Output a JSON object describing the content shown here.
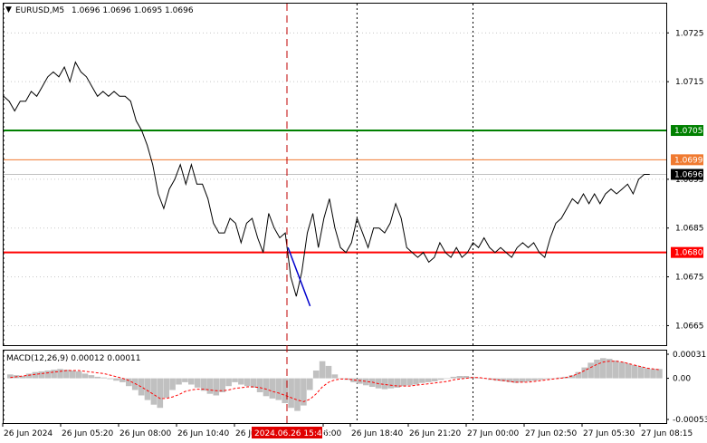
{
  "chart_header": {
    "symbol_label": "EURUSD,M5",
    "ohlc": "1.0696 1.0696 1.0695 1.0696"
  },
  "macd_header": {
    "label": "MACD(12,26,9) 0.00012 0.00011"
  },
  "price_axis_ticks": [
    "1.0725",
    "1.0715",
    "1.0695",
    "1.0685",
    "1.0675",
    "1.0665"
  ],
  "price_axis_tick_values": [
    1.0725,
    1.0715,
    1.0695,
    1.0685,
    1.0675,
    1.0665
  ],
  "macd_axis_ticks": [
    "0.00031",
    "0.00",
    "-0.00053"
  ],
  "macd_axis_tick_values": [
    0.00031,
    0.0,
    -0.00053
  ],
  "time_axis_labels": [
    "26 Jun 2024",
    "26 Jun 05:20",
    "26 Jun 08:00",
    "26 Jun 10:40",
    "26 Jun",
    "6:00",
    "26 Jun 18:40",
    "26 Jun 21:20",
    "27 Jun 00:00",
    "27 Jun 02:50",
    "27 Jun 05:30",
    "27 Jun 08:15"
  ],
  "crosshair_time": "2024.06.26 15:45",
  "levels": [
    {
      "name": "green-level",
      "price": 1.0705,
      "label": "1.0705",
      "color": "#008000"
    },
    {
      "name": "orange-level",
      "price": 1.0699,
      "label": "1.0699",
      "color": "#f07a30"
    },
    {
      "name": "red-level",
      "price": 1.068,
      "label": "1.0680",
      "color": "#ff0000"
    },
    {
      "name": "current-price",
      "price": 1.0696,
      "label": "1.0696",
      "color": "#000000"
    }
  ],
  "colors": {
    "price_line": "#000000",
    "macd_histogram": "#c0c0c0",
    "macd_signal": "#ff0000",
    "trend_line": "#0000cc",
    "crosshair": "#c00000",
    "grid": "#c8c8c8",
    "time_tag_bg": "#e00000"
  },
  "chart_data": [
    {
      "type": "line",
      "title": "EURUSD,M5",
      "ylim": [
        1.0661,
        1.0731
      ],
      "x_index_range": [
        0,
        120
      ],
      "x_major": [
        0,
        64,
        85
      ],
      "y": [
        1.0712,
        1.0711,
        1.0709,
        1.0711,
        1.0711,
        1.0713,
        1.0712,
        1.0714,
        1.0716,
        1.0717,
        1.0716,
        1.0718,
        1.0715,
        1.0719,
        1.0717,
        1.0716,
        1.0714,
        1.0712,
        1.0713,
        1.0712,
        1.0713,
        1.0712,
        1.0712,
        1.0711,
        1.0707,
        1.0705,
        1.0702,
        1.0698,
        1.0692,
        1.0689,
        1.0693,
        1.0695,
        1.0698,
        1.0694,
        1.0698,
        1.0694,
        1.0694,
        1.0691,
        1.0686,
        1.0684,
        1.0684,
        1.0687,
        1.0686,
        1.0682,
        1.0686,
        1.0687,
        1.0683,
        1.068,
        1.0688,
        1.0685,
        1.0683,
        1.0684,
        1.0675,
        1.0671,
        1.0676,
        1.0684,
        1.0688,
        1.0681,
        1.0687,
        1.0691,
        1.0685,
        1.0681,
        1.068,
        1.0682,
        1.0687,
        1.0684,
        1.0681,
        1.0685,
        1.0685,
        1.0684,
        1.0686,
        1.069,
        1.0687,
        1.0681,
        1.068,
        1.0679,
        1.068,
        1.0678,
        1.0679,
        1.0682,
        1.068,
        1.0679,
        1.0681,
        1.0679,
        1.068,
        1.0682,
        1.0681,
        1.0683,
        1.0681,
        1.068,
        1.0681,
        1.068,
        1.0679,
        1.0681,
        1.0682,
        1.0681,
        1.0682,
        1.068,
        1.0679,
        1.0683,
        1.0686,
        1.0687,
        1.0689,
        1.0691,
        1.069,
        1.0692,
        1.069,
        1.0692,
        1.069,
        1.0692,
        1.0693,
        1.0692,
        1.0693,
        1.0694,
        1.0692,
        1.0695,
        1.0696,
        1.0696
      ],
      "trend_line": {
        "start": [
          51.5,
          1.0681
        ],
        "end": [
          55.5,
          1.0669
        ]
      },
      "levels": [
        1.0705,
        1.0699,
        1.068
      ]
    },
    {
      "type": "bar",
      "title": "MACD(12,26,9)",
      "ylim": [
        -0.00053,
        0.00031
      ],
      "histogram": [
        5e-05,
        4e-05,
        3e-05,
        6e-05,
        8e-05,
        9e-05,
        0.0001,
        0.00011,
        0.00012,
        0.00011,
        0.0001,
        9e-05,
        6e-05,
        4e-05,
        2e-05,
        1e-05,
        -1e-05,
        -3e-05,
        -5e-05,
        -0.0001,
        -0.00015,
        -0.00022,
        -0.00028,
        -0.00034,
        -0.00038,
        -0.00025,
        -0.00015,
        -8e-05,
        -5e-05,
        -8e-05,
        -0.00012,
        -0.00016,
        -0.0002,
        -0.00022,
        -0.00018,
        -0.0001,
        -5e-05,
        -8e-05,
        -0.0001,
        -0.00012,
        -0.00018,
        -0.00023,
        -0.00026,
        -0.00028,
        -0.00032,
        -0.00038,
        -0.00042,
        -0.00035,
        -0.00015,
        0.0001,
        0.00022,
        0.00016,
        5e-05,
        0.0,
        -2e-05,
        -5e-05,
        -7e-05,
        -9e-05,
        -0.00011,
        -0.00013,
        -0.00014,
        -0.00013,
        -0.00012,
        -0.0001,
        -9e-05,
        -8e-05,
        -6e-05,
        -5e-05,
        -4e-05,
        -2e-05,
        0.0,
        2e-05,
        3e-05,
        3e-05,
        2e-05,
        1e-05,
        0.0,
        -2e-05,
        -3e-05,
        -4e-05,
        -5e-05,
        -6e-05,
        -5e-05,
        -4e-05,
        -3e-05,
        -2e-05,
        -1e-05,
        0.0,
        1e-05,
        2e-05,
        4e-05,
        8e-05,
        0.00014,
        0.0002,
        0.00024,
        0.00026,
        0.00025,
        0.00023,
        0.00021,
        0.00019,
        0.00017,
        0.00015,
        0.00013,
        0.00012,
        0.00012
      ],
      "signal": [
        1e-05,
        2e-05,
        3e-05,
        4e-05,
        5e-05,
        6e-05,
        7e-05,
        8e-05,
        9e-05,
        0.0001,
        0.0001,
        0.0001,
        9e-05,
        8e-05,
        7e-05,
        6e-05,
        4e-05,
        2e-05,
        0.0,
        -3e-05,
        -7e-05,
        -0.00011,
        -0.00016,
        -0.00021,
        -0.00026,
        -0.00026,
        -0.00024,
        -0.00021,
        -0.00017,
        -0.00015,
        -0.00014,
        -0.00014,
        -0.00015,
        -0.00016,
        -0.00016,
        -0.00015,
        -0.00013,
        -0.00012,
        -0.00011,
        -0.00011,
        -0.00012,
        -0.00014,
        -0.00017,
        -0.00019,
        -0.00022,
        -0.00025,
        -0.00028,
        -0.0003,
        -0.00027,
        -0.0002,
        -0.00011,
        -5e-05,
        -2e-05,
        -1e-05,
        -1e-05,
        -2e-05,
        -3e-05,
        -4e-05,
        -5e-05,
        -7e-05,
        -8e-05,
        -9e-05,
        -0.0001,
        -0.0001,
        -0.0001,
        -9e-05,
        -8e-05,
        -7e-05,
        -6e-05,
        -5e-05,
        -4e-05,
        -2e-05,
        -1e-05,
        0.0,
        1e-05,
        1e-05,
        0.0,
        -1e-05,
        -2e-05,
        -3e-05,
        -4e-05,
        -5e-05,
        -5e-05,
        -5e-05,
        -4e-05,
        -3e-05,
        -2e-05,
        -1e-05,
        0.0,
        1e-05,
        3e-05,
        6e-05,
        0.0001,
        0.00014,
        0.00018,
        0.00021,
        0.00022,
        0.00022,
        0.00021,
        0.00019,
        0.00017,
        0.00015,
        0.00013,
        0.00012,
        0.00011
      ]
    }
  ]
}
